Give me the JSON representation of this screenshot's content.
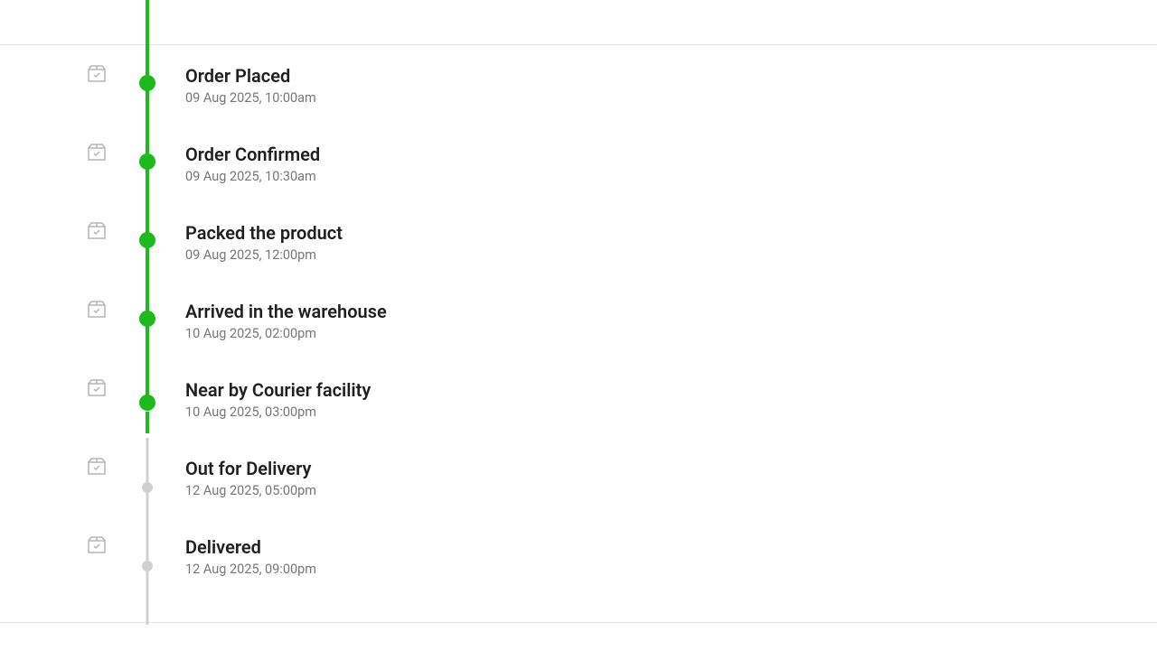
{
  "timeline": {
    "steps": [
      {
        "title": "Order Placed",
        "timestamp": "09 Aug 2025, 10:00am",
        "status": "complete"
      },
      {
        "title": "Order Confirmed",
        "timestamp": "09 Aug 2025, 10:30am",
        "status": "complete"
      },
      {
        "title": "Packed the product",
        "timestamp": "09 Aug 2025, 12:00pm",
        "status": "complete"
      },
      {
        "title": "Arrived in the warehouse",
        "timestamp": "10 Aug 2025, 02:00pm",
        "status": "complete"
      },
      {
        "title": "Near by Courier facility",
        "timestamp": "10 Aug 2025, 03:00pm",
        "status": "current"
      },
      {
        "title": "Out for Delivery",
        "timestamp": "12 Aug 2025, 05:00pm",
        "status": "pending"
      },
      {
        "title": "Delivered",
        "timestamp": "12 Aug 2025, 09:00pm",
        "status": "pending"
      }
    ]
  },
  "colors": {
    "green": "#1db91d",
    "gray": "#d0d0d0",
    "text_dark": "#1f1f1f",
    "text_muted": "#777777"
  }
}
